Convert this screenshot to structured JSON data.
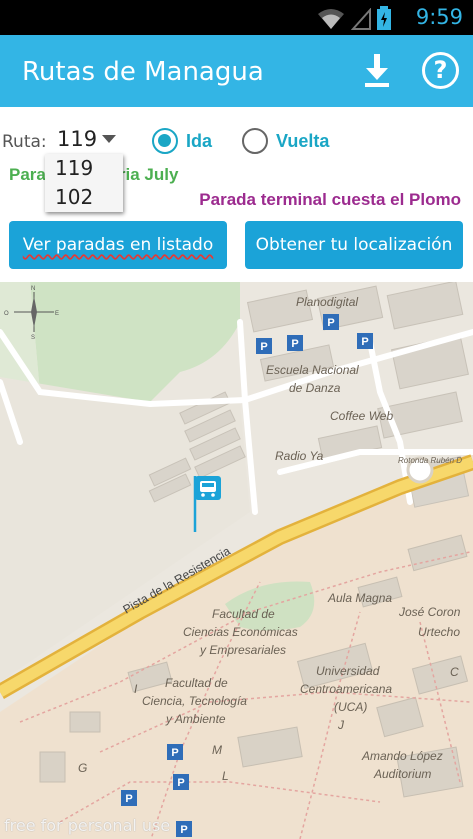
{
  "status_bar": {
    "time": "9:59",
    "icons": [
      "wifi-icon",
      "signal-icon",
      "battery-charging-icon"
    ]
  },
  "action_bar": {
    "title": "Rutas de Managua",
    "download_icon": "download-icon",
    "help_label": "?"
  },
  "controls": {
    "ruta_label": "Ruta:",
    "ruta_value": "119",
    "dropdown_options": [
      "119",
      "102"
    ],
    "radio_ida": "Ida",
    "radio_vuelta": "Vuelta",
    "selected_direction": "Ida",
    "stop_left": "Parada Galeria July",
    "stop_left_visible": "Para",
    "stop_left_visible_tail": "ria July",
    "stop_right": "Parada terminal cuesta el Plomo",
    "btn_list": "Ver paradas en listado",
    "btn_location": "Obtener tu localización"
  },
  "map": {
    "labels": {
      "planodigital": "Planodigital",
      "escuela": "Escuela Nacional",
      "danza": "de Danza",
      "coffee": "Coffee Web",
      "radio": "Radio Ya",
      "rotonda": "Rotonda Rubén D",
      "pista": "Pista de la Resistencia",
      "aula": "Aula Magna",
      "jose": "José Coron",
      "urtecho": "Urtecho",
      "facultad1": "Facultad de",
      "facultad1b": "Ciencias Económicas",
      "facultad1c": "y Empresariales",
      "universidad": "Universidad",
      "centroamericana": "Centroamericana",
      "uca": "(UCA)",
      "facultad2": "Facultad de",
      "facultad2b": "Ciencia, Tecnología",
      "facultad2c": "y Ambiente",
      "amando": "Amando López",
      "auditorium": "Auditorium",
      "g": "G",
      "m": "M",
      "l": "L",
      "c": "C",
      "i": "I",
      "j": "J",
      "compass_n": "N",
      "compass_s": "S",
      "compass_e": "E",
      "compass_o": "O",
      "parking": "P"
    },
    "watermark": "free for personal use"
  },
  "colors": {
    "accent": "#33b5e5",
    "button": "#1ba3d8",
    "radio": "#1aa6c5",
    "stop_left": "#4caf50",
    "stop_right": "#9c2b8f",
    "road": "#f2c94c"
  }
}
